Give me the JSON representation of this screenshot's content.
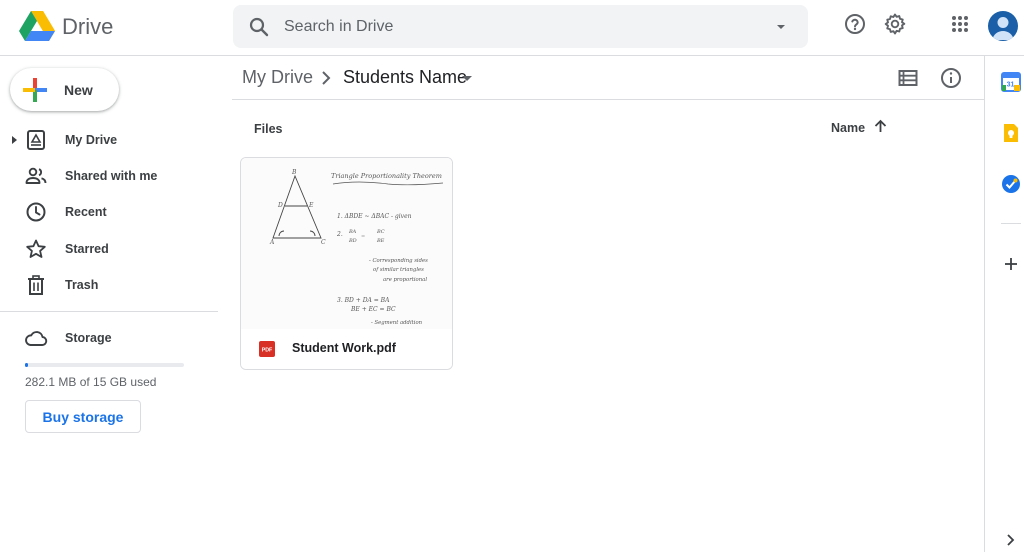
{
  "app": {
    "name": "Drive"
  },
  "search": {
    "placeholder": "Search in Drive"
  },
  "sidebar": {
    "new_label": "New",
    "items": [
      {
        "label": "My Drive",
        "icon": "my-drive-icon"
      },
      {
        "label": "Shared with me",
        "icon": "shared-icon"
      },
      {
        "label": "Recent",
        "icon": "clock-icon"
      },
      {
        "label": "Starred",
        "icon": "star-icon"
      },
      {
        "label": "Trash",
        "icon": "trash-icon"
      },
      {
        "label": "Storage",
        "icon": "cloud-icon"
      }
    ],
    "storage": {
      "used_text": "282.1 MB of 15 GB used",
      "used_fraction": 0.018,
      "buy_label": "Buy storage"
    }
  },
  "breadcrumb": {
    "root": "My Drive",
    "current": "Students Name"
  },
  "files_section": {
    "label": "Files",
    "sort_label": "Name"
  },
  "files": [
    {
      "name": "Student Work.pdf",
      "type": "pdf",
      "type_badge": "PDF"
    }
  ],
  "thumbnail_text": {
    "title": "Triangle Proportionality Theorem",
    "line1": "1.  ΔBDE ~ ΔBAC   - given",
    "line2a": "BA",
    "line2b": "BD",
    "line2c": "BC",
    "line2d": "BE",
    "line3": "- Corresponding sides",
    "line4": "of similar triangles",
    "line5": "are proportional",
    "line6": "3.  BD + DA = BA",
    "line7": "BE + EC = BC",
    "line8": "- Segment addition",
    "vB": "B",
    "vD": "D",
    "vE": "E",
    "vA": "A",
    "vC": "C"
  },
  "side_panel": {
    "calendar_day": "31"
  },
  "colors": {
    "accent": "#1a73e8",
    "pdf": "#d93025",
    "keep": "#fbbc04",
    "avatar": "#1a5fa8"
  }
}
